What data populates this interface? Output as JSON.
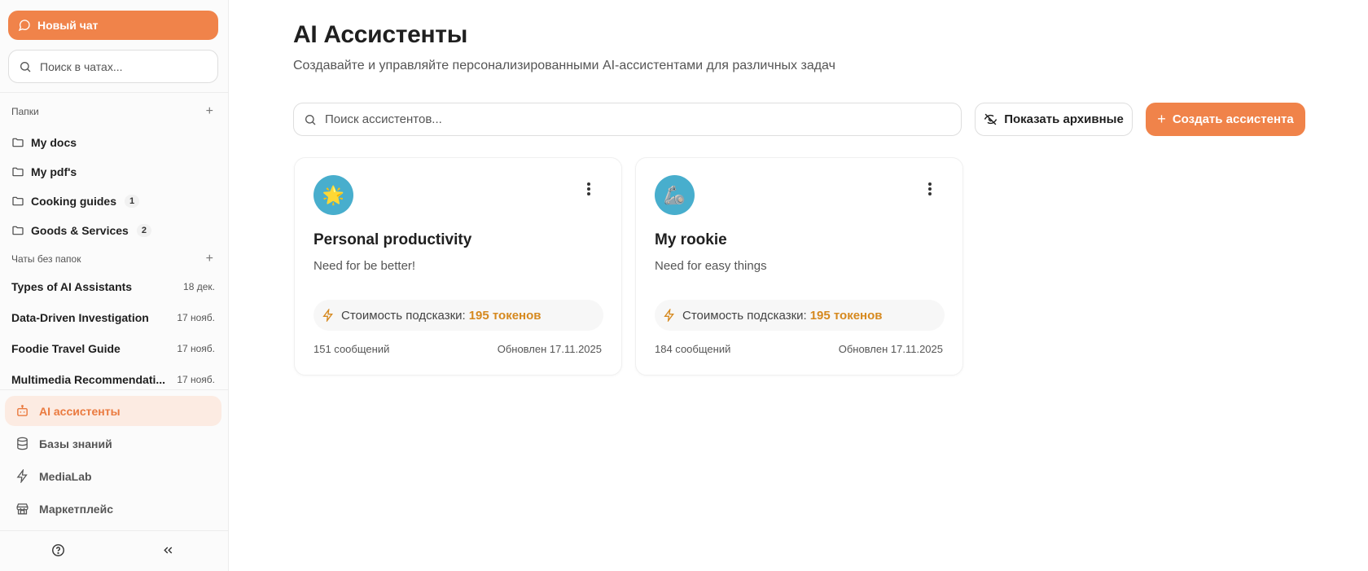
{
  "sidebar": {
    "new_chat_label": "Новый чат",
    "search_placeholder": "Поиск в чатах...",
    "folders_title": "Папки",
    "folders": [
      {
        "name": "My docs",
        "count": ""
      },
      {
        "name": "My pdf's",
        "count": ""
      },
      {
        "name": "Cooking guides",
        "count": "1"
      },
      {
        "name": "Goods & Services",
        "count": "2"
      }
    ],
    "unfiled_title": "Чаты без папок",
    "chats": [
      {
        "title": "Types of AI Assistants",
        "date": "18 дек."
      },
      {
        "title": "Data-Driven Investigation",
        "date": "17 нояб."
      },
      {
        "title": "Foodie Travel Guide",
        "date": "17 нояб."
      },
      {
        "title": "Multimedia Recommendati...",
        "date": "17 нояб."
      }
    ],
    "nav": [
      {
        "label": "AI ассистенты",
        "icon": "bot-icon",
        "active": true
      },
      {
        "label": "Базы знаний",
        "icon": "database-icon",
        "active": false
      },
      {
        "label": "MediaLab",
        "icon": "lightning-icon",
        "active": false
      },
      {
        "label": "Маркетплейс",
        "icon": "store-icon",
        "active": false
      }
    ]
  },
  "main": {
    "title": "AI Ассистенты",
    "subtitle": "Создавайте и управляйте персонализированными AI-ассистентами для различных задач",
    "search_placeholder": "Поиск ассистентов...",
    "archive_label": "Показать архивные",
    "create_label": "Создать ассистента",
    "cards": [
      {
        "emoji": "🌟",
        "name": "Personal productivity",
        "description": "Need for be better!",
        "cost_label": "Стоимость подсказки:",
        "cost_value": "195 токенов",
        "messages": "151 сообщений",
        "updated": "Обновлен 17.11.2025"
      },
      {
        "emoji": "🦾",
        "name": "My rookie",
        "description": "Need for easy things",
        "cost_label": "Стоимость подсказки:",
        "cost_value": "195 токенов",
        "messages": "184 сообщений",
        "updated": "Обновлен 17.11.2025"
      }
    ]
  },
  "colors": {
    "accent": "#f0834a",
    "accent_soft": "#fcebe2",
    "token_color": "#d6891f",
    "avatar_bg": "#48aecd"
  }
}
